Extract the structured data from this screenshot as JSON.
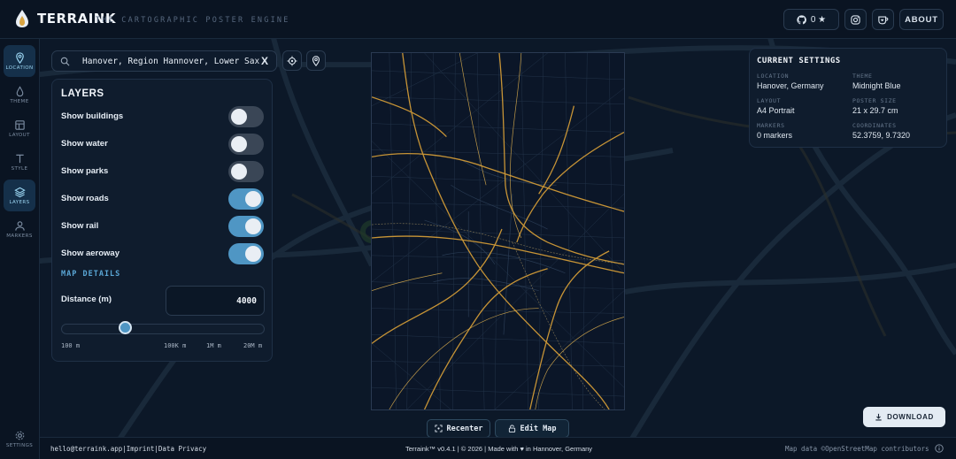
{
  "header": {
    "brand": "TERRAINK",
    "tagline": "THE CARTOGRAPHIC POSTER ENGINE",
    "github_stars": "0 ★",
    "about_label": "ABOUT"
  },
  "sidebar": {
    "items": [
      {
        "label": "LOCATION",
        "icon": "location-pin-icon",
        "active": true
      },
      {
        "label": "THEME",
        "icon": "droplet-icon",
        "active": false
      },
      {
        "label": "LAYOUT",
        "icon": "layout-icon",
        "active": false
      },
      {
        "label": "STYLE",
        "icon": "text-icon",
        "active": false
      },
      {
        "label": "LAYERS",
        "icon": "layers-icon",
        "active": true
      },
      {
        "label": "MARKERS",
        "icon": "person-icon",
        "active": false
      }
    ],
    "settings_label": "SETTINGS"
  },
  "search": {
    "value": "Hanover, Region Hannover, Lower Saxony, Germany",
    "clear": "X"
  },
  "layers": {
    "title": "LAYERS",
    "toggles": [
      {
        "label": "Show buildings",
        "on": false
      },
      {
        "label": "Show water",
        "on": false
      },
      {
        "label": "Show parks",
        "on": false
      },
      {
        "label": "Show roads",
        "on": true
      },
      {
        "label": "Show rail",
        "on": true
      },
      {
        "label": "Show aeroway",
        "on": true
      }
    ],
    "map_details": "MAP DETAILS",
    "distance_label": "Distance (m)",
    "distance_value": "4000",
    "slider_ticks": [
      "100 m",
      "100K m",
      "1M m",
      "20M m"
    ],
    "slider_level": 0.3
  },
  "map_actions": {
    "recenter": "Recenter",
    "edit_map": "Edit Map"
  },
  "settings": {
    "title": "CURRENT SETTINGS",
    "location_key": "LOCATION",
    "location": "Hanover, Germany",
    "theme_key": "THEME",
    "theme": "Midnight Blue",
    "layout_key": "LAYOUT",
    "layout": "A4 Portrait",
    "size_key": "POSTER SIZE",
    "size": "21 x 29.7 cm",
    "markers_key": "MARKERS",
    "markers": "0 markers",
    "coords_key": "COORDINATES",
    "coords": "52.3759, 9.7320"
  },
  "download_label": "DOWNLOAD",
  "footer": {
    "email": "hello@terraink.app",
    "sep": "|",
    "imprint": "Imprint",
    "privacy": "Data Privacy",
    "center": "Terraink™ v0.4.1 | © 2026 | Made with ♥ in Hannover, Germany",
    "map_data": "Map data ©OpenStreetMap contributors"
  },
  "colors": {
    "accent": "#4f96c4",
    "road": "#d9a441",
    "background": "#0b1726"
  }
}
